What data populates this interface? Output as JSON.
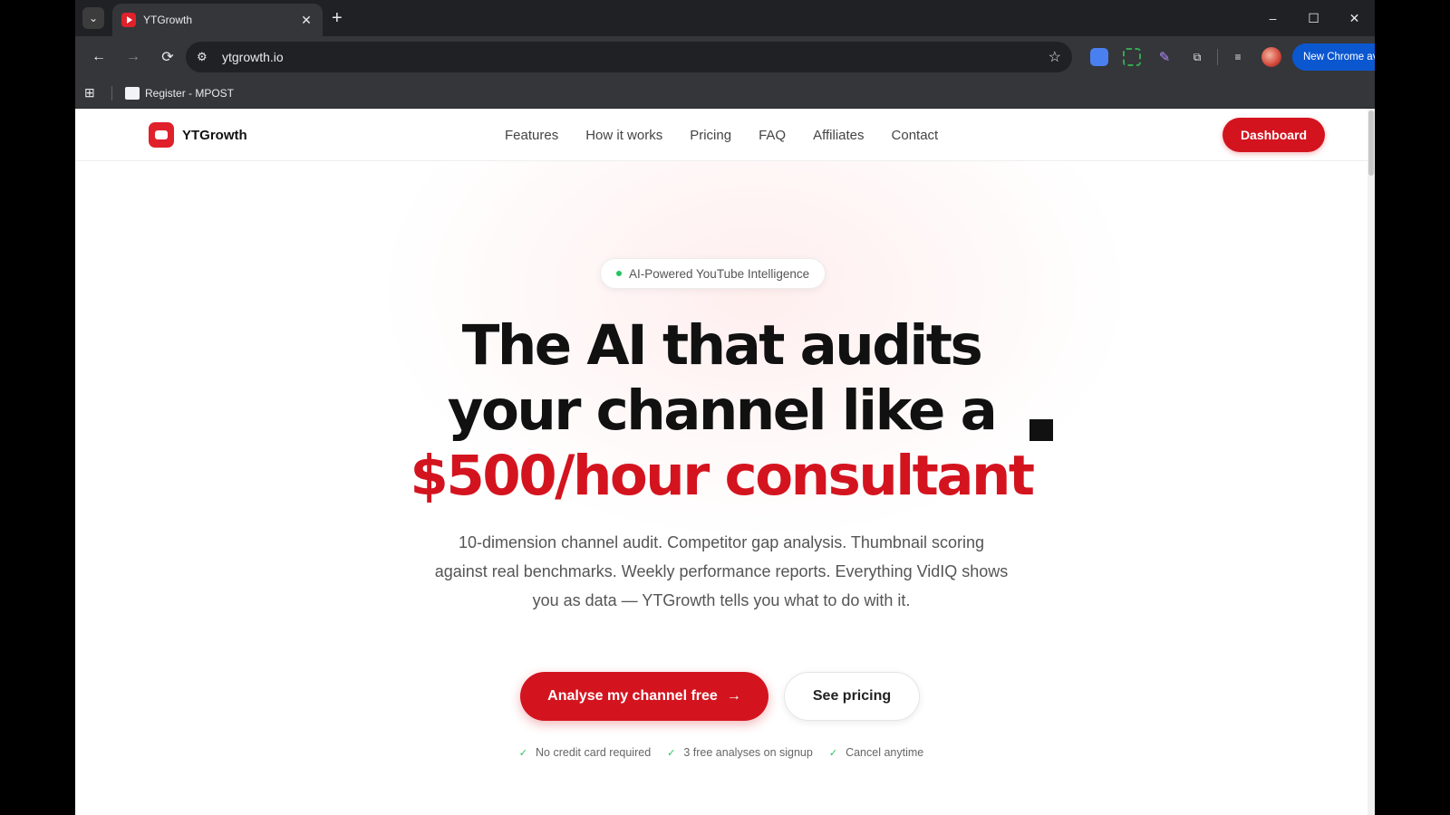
{
  "browser": {
    "tab": {
      "title": "YTGrowth",
      "close_icon": "✕"
    },
    "tab_search_icon": "⌄",
    "new_tab_icon": "+",
    "window_controls": {
      "minimize": "–",
      "maximize": "☐",
      "close": "✕"
    },
    "nav": {
      "back": "←",
      "forward": "→",
      "reload": "⟳"
    },
    "address": {
      "url": "ytgrowth.io",
      "tune_icon": "⚙",
      "star_icon": "☆"
    },
    "extensions": {
      "puzzle": "⧉",
      "media": "≡",
      "pen": "✎"
    },
    "update_label": "New Chrome available",
    "update_menu": "⋮",
    "bookmarks": {
      "apps_icon": "⊞",
      "items": [
        {
          "label": "Register - MPOST"
        }
      ]
    }
  },
  "site": {
    "brand": "YTGrowth",
    "nav_links": [
      "Features",
      "How it works",
      "Pricing",
      "FAQ",
      "Affiliates",
      "Contact"
    ],
    "dashboard_label": "Dashboard",
    "badge": "AI-Powered YouTube Intelligence",
    "headline": {
      "line1": "The AI that audits",
      "line2": "your channel like a",
      "line3": "$500/hour consultant"
    },
    "subtext": "10-dimension channel audit. Competitor gap analysis. Thumbnail scoring against real benchmarks. Weekly performance reports. Everything VidIQ shows you as data — YTGrowth tells you what to do with it.",
    "cta_primary": "Analyse my channel free",
    "cta_arrow": "→",
    "cta_secondary": "See pricing",
    "perk_check": "✓",
    "perks": [
      "No credit card required",
      "3 free analyses on signup",
      "Cancel anytime"
    ]
  },
  "colors": {
    "brand_red": "#d3141f",
    "check_green": "#22c55e",
    "chrome_update_blue": "#0b57d0"
  }
}
